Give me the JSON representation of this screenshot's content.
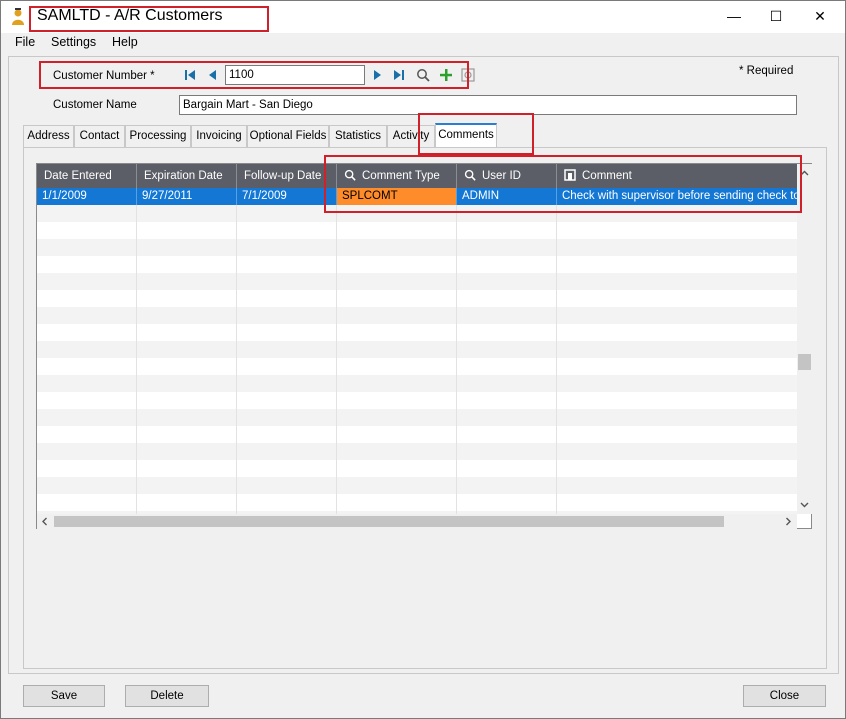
{
  "window": {
    "title": "SAMLTD - A/R Customers",
    "minimize": "—",
    "maximize": "☐",
    "close": "✕"
  },
  "menu": [
    "File",
    "Settings",
    "Help"
  ],
  "form": {
    "customer_number_label": "Customer Number *",
    "customer_number_value": "1100",
    "customer_name_label": "Customer Name",
    "customer_name_value": "Bargain Mart - San Diego",
    "required_label": "*  Required"
  },
  "tabs": [
    {
      "label": "Address"
    },
    {
      "label": "Contact"
    },
    {
      "label": "Processing"
    },
    {
      "label": "Invoicing"
    },
    {
      "label": "Optional Fields"
    },
    {
      "label": "Statistics"
    },
    {
      "label": "Activity"
    },
    {
      "label": "Comments",
      "active": true
    }
  ],
  "grid": {
    "columns": [
      "Date Entered",
      "Expiration Date",
      "Follow-up Date",
      "Comment Type",
      "User ID",
      "Comment"
    ],
    "rows": [
      [
        "1/1/2009",
        "9/27/2011",
        "7/1/2009",
        "SPLCOMT",
        "ADMIN",
        "Check with supervisor before sending check to na"
      ]
    ]
  },
  "buttons": {
    "save": "Save",
    "delete": "Delete",
    "close": "Close"
  },
  "colors": {
    "selection": "#1477d4",
    "highlight_cell": "#ff8c2a",
    "header": "#5b5e66",
    "annotation": "#d0202a"
  }
}
